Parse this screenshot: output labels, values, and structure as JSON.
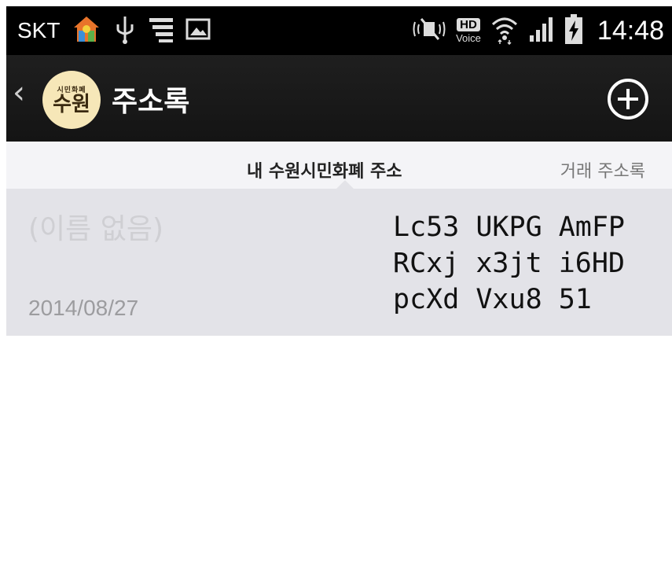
{
  "status_bar": {
    "carrier": "SKT",
    "hd_label": "HD",
    "voice_label": "Voice",
    "time": "14:48"
  },
  "action_bar": {
    "logo_small_text": "시민화폐",
    "logo_text": "수원",
    "title": "주소록"
  },
  "tabs": {
    "active": "내 수원시민화폐 주소",
    "other": "거래 주소록"
  },
  "address_item": {
    "name": "(이름 없음)",
    "date": "2014/08/27",
    "address_lines": [
      "Lc53 UKPG AmFP",
      "RCxj x3jt i6HD",
      "pcXd Vxu8 51"
    ]
  },
  "colors": {
    "status_bar_bg": "#000000",
    "action_bar_bg": "#1a1a1a",
    "tab_bg": "#f4f4f7",
    "row_bg": "#e3e3e8",
    "logo_bg": "#f6e7b8"
  }
}
